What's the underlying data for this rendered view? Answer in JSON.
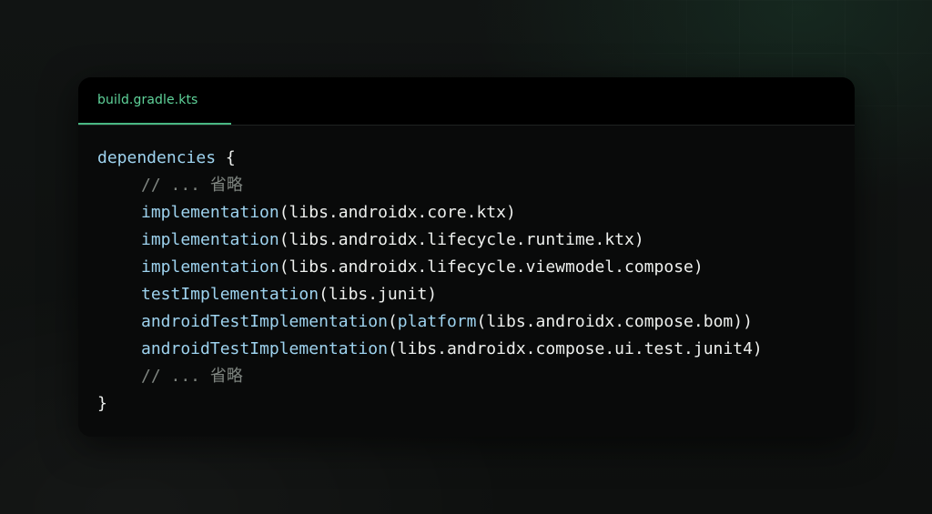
{
  "tab": {
    "filename": "build.gradle.kts"
  },
  "code": {
    "lines": [
      {
        "indent": 0,
        "parts": [
          {
            "t": "kw",
            "v": "dependencies"
          },
          {
            "t": "tx",
            "v": " {"
          }
        ]
      },
      {
        "indent": 1,
        "parts": [
          {
            "t": "cm",
            "v": "// ... 省略"
          }
        ]
      },
      {
        "indent": 1,
        "parts": [
          {
            "t": "fn",
            "v": "implementation"
          },
          {
            "t": "tx",
            "v": "(libs.androidx.core.ktx)"
          }
        ]
      },
      {
        "indent": 1,
        "parts": [
          {
            "t": "fn",
            "v": "implementation"
          },
          {
            "t": "tx",
            "v": "(libs.androidx.lifecycle.runtime.ktx)"
          }
        ]
      },
      {
        "indent": 1,
        "parts": [
          {
            "t": "fn",
            "v": "implementation"
          },
          {
            "t": "tx",
            "v": "(libs.androidx.lifecycle.viewmodel.compose)"
          }
        ]
      },
      {
        "indent": 1,
        "parts": [
          {
            "t": "fn",
            "v": "testImplementation"
          },
          {
            "t": "tx",
            "v": "(libs.junit)"
          }
        ]
      },
      {
        "indent": 1,
        "parts": [
          {
            "t": "fn",
            "v": "androidTestImplementation"
          },
          {
            "t": "tx",
            "v": "("
          },
          {
            "t": "fn",
            "v": "platform"
          },
          {
            "t": "tx",
            "v": "(libs.androidx.compose.bom))"
          }
        ]
      },
      {
        "indent": 1,
        "parts": [
          {
            "t": "fn",
            "v": "androidTestImplementation"
          },
          {
            "t": "tx",
            "v": "(libs.androidx.compose.ui.test.junit4)"
          }
        ]
      },
      {
        "indent": 1,
        "parts": [
          {
            "t": "cm",
            "v": "// ... 省略"
          }
        ]
      },
      {
        "indent": 0,
        "parts": [
          {
            "t": "tx",
            "v": "}"
          }
        ]
      }
    ]
  },
  "colors": {
    "tab_accent": "#49b883",
    "tab_text": "#5fd39a",
    "identifier": "#9ed3ef",
    "comment": "#7f8580",
    "plain_text": "#eef0ee",
    "panel_background": "#090a0a"
  }
}
